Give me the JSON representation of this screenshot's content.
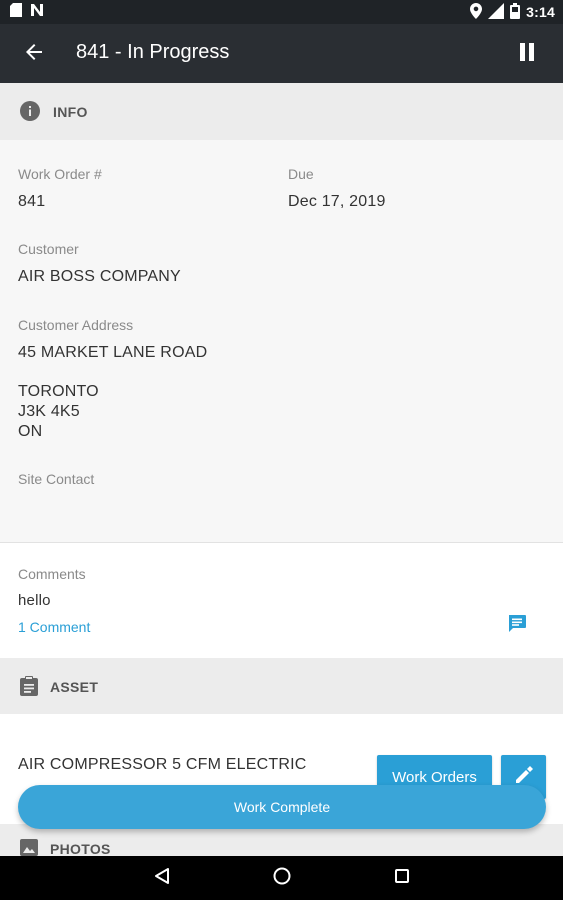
{
  "status_bar": {
    "time": "3:14",
    "left_icons": [
      "sd-card-icon",
      "n-notification-icon"
    ],
    "right_icons": [
      "location-icon",
      "signal-icon",
      "battery-icon"
    ]
  },
  "app_bar": {
    "title": "841 - In Progress",
    "back_icon": "arrow-left-icon",
    "pause_icon": "pause-icon"
  },
  "info": {
    "header": "INFO",
    "icon": "info-icon",
    "work_order_label": "Work Order #",
    "work_order_value": "841",
    "due_label": "Due",
    "due_value": "Dec 17, 2019",
    "customer_label": "Customer",
    "customer_value": "AIR BOSS COMPANY",
    "address_label": "Customer Address",
    "address_line1": "45 MARKET LANE ROAD",
    "address_city": "TORONTO",
    "address_postal": "J3K 4K5",
    "address_province": "ON",
    "site_contact_label": "Site Contact"
  },
  "comments": {
    "label": "Comments",
    "text": "hello",
    "count_link": "1 Comment",
    "icon": "comment-icon"
  },
  "asset": {
    "header": "ASSET",
    "icon": "clipboard-icon",
    "name": "AIR COMPRESSOR 5 CFM ELECTRIC",
    "work_orders_button": "Work Orders",
    "edit_icon": "pencil-icon"
  },
  "work_complete_button": "Work Complete",
  "photos": {
    "header": "PHOTOS",
    "icon": "image-icon"
  },
  "colors": {
    "app_bar": "#2a2e33",
    "status_bar": "#1f2327",
    "accent": "#2a9fd6",
    "section_header_bg": "#ececec",
    "info_bg": "#f7f7f7"
  }
}
